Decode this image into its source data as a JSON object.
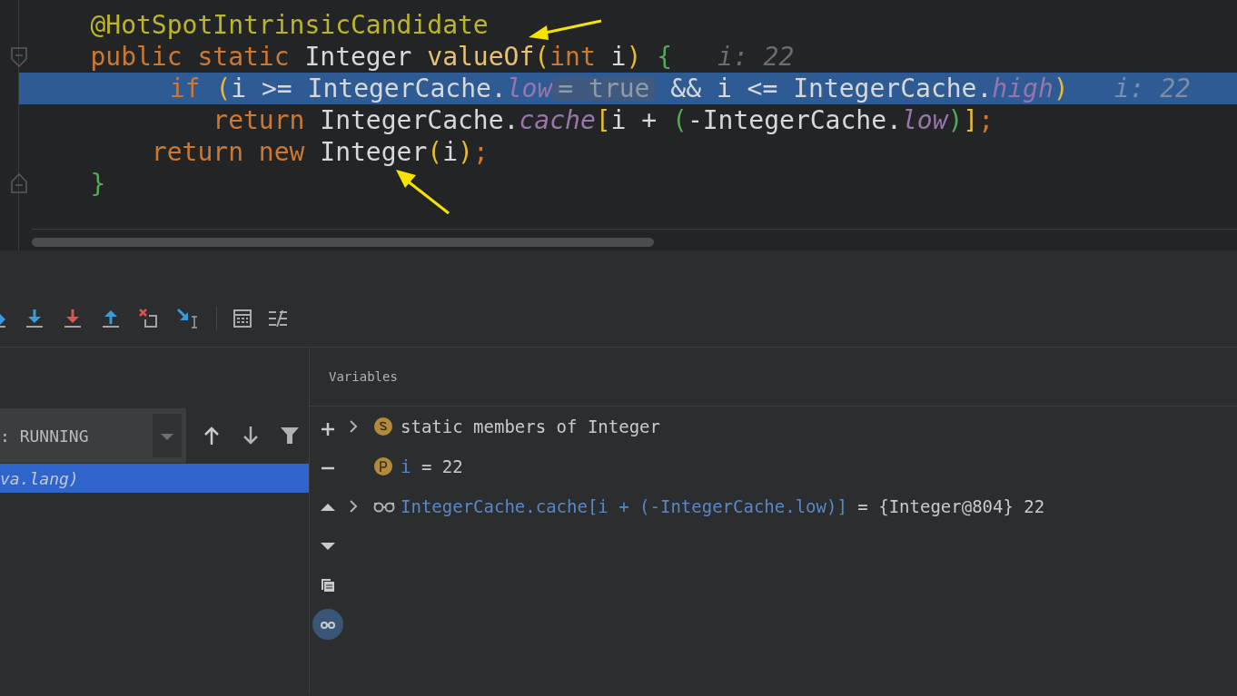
{
  "editor": {
    "lines": [
      {
        "highlighted": false,
        "tokens": [
          {
            "text": "    @HotSpotIntrinsicCandidate",
            "kind": "annotation"
          }
        ]
      },
      {
        "highlighted": false,
        "hint": "i: 22",
        "tokens": [
          {
            "text": "    public static ",
            "kind": "keyword"
          },
          {
            "text": "Integer ",
            "kind": "plain"
          },
          {
            "text": "valueOf",
            "kind": "method"
          },
          {
            "text": "(",
            "kind": "paren"
          },
          {
            "text": "int ",
            "kind": "keyword"
          },
          {
            "text": "i",
            "kind": "plain"
          },
          {
            "text": ") ",
            "kind": "paren"
          },
          {
            "text": "{",
            "kind": "brace"
          }
        ]
      },
      {
        "highlighted": true,
        "hint": "i: 22",
        "tokens": [
          {
            "text": "        if ",
            "kind": "keyword"
          },
          {
            "text": "(",
            "kind": "paren"
          },
          {
            "text": "i >= IntegerCache.",
            "kind": "plain"
          },
          {
            "text": "low",
            "kind": "field"
          },
          {
            "text": "= true",
            "kind": "inline-value"
          },
          {
            "text": " && i <= IntegerCache.",
            "kind": "plain"
          },
          {
            "text": "high",
            "kind": "field"
          },
          {
            "text": ")",
            "kind": "paren"
          }
        ]
      },
      {
        "highlighted": false,
        "tokens": [
          {
            "text": "            return ",
            "kind": "keyword"
          },
          {
            "text": "IntegerCache.",
            "kind": "plain"
          },
          {
            "text": "cache",
            "kind": "field"
          },
          {
            "text": "[",
            "kind": "paren"
          },
          {
            "text": "i + ",
            "kind": "plain"
          },
          {
            "text": "(",
            "kind": "brace"
          },
          {
            "text": "-IntegerCache.",
            "kind": "plain"
          },
          {
            "text": "low",
            "kind": "field"
          },
          {
            "text": ")",
            "kind": "brace"
          },
          {
            "text": "]",
            "kind": "paren"
          },
          {
            "text": ";",
            "kind": "keyword"
          }
        ]
      },
      {
        "highlighted": false,
        "tokens": [
          {
            "text": "        return new ",
            "kind": "keyword"
          },
          {
            "text": "Integer",
            "kind": "plain"
          },
          {
            "text": "(",
            "kind": "paren"
          },
          {
            "text": "i",
            "kind": "plain"
          },
          {
            "text": ")",
            "kind": "paren"
          },
          {
            "text": ";",
            "kind": "keyword"
          }
        ]
      },
      {
        "highlighted": false,
        "tokens": [
          {
            "text": "    }",
            "kind": "brace"
          }
        ]
      }
    ]
  },
  "frames": {
    "thread": ": RUNNING",
    "items": [
      {
        "text": "va.lang)",
        "selected": true
      }
    ]
  },
  "variables": {
    "title": "Variables",
    "side_toolbar": [
      {
        "kind": "add",
        "selected": false
      },
      {
        "kind": "remove",
        "selected": false
      },
      {
        "kind": "up",
        "selected": false
      },
      {
        "kind": "down",
        "selected": false
      },
      {
        "kind": "copy",
        "selected": false
      },
      {
        "kind": "watches",
        "selected": true
      }
    ],
    "items": [
      {
        "kind": "static",
        "expandable": true,
        "name": "static members of Integer"
      },
      {
        "kind": "param",
        "expandable": false,
        "name": "i",
        "value": " = 22"
      },
      {
        "kind": "watch",
        "expandable": true,
        "name": "IntegerCache.cache[i + (-IntegerCache.low)]",
        "value": " = {Integer@804} 22"
      }
    ]
  }
}
